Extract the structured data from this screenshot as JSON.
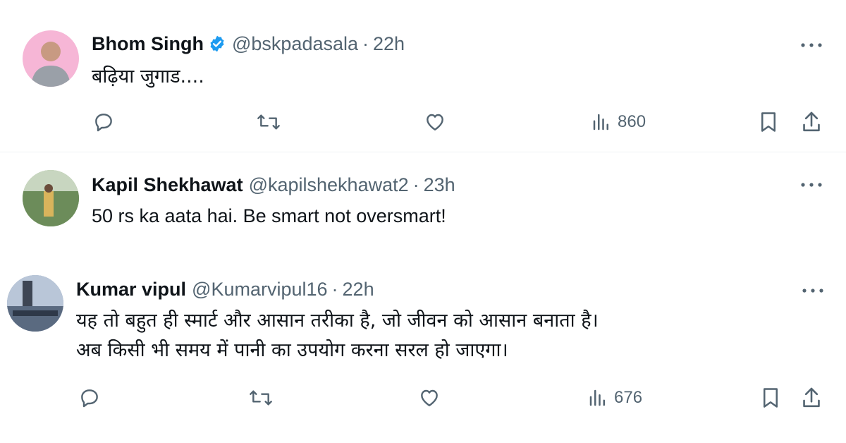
{
  "replies": [
    {
      "name": "Bhom Singh",
      "verified": true,
      "handle": "@bskpadasala",
      "time": "22h",
      "text": [
        "बढ़िया जुगाड...."
      ],
      "views": "860",
      "avatar_bg": "#f6b6d6"
    },
    {
      "name": "Kapil Shekhawat",
      "verified": false,
      "handle": "@kapilshekhawat2",
      "time": "23h",
      "text": [
        "50 rs ka aata hai. Be smart not oversmart!"
      ],
      "views": "",
      "avatar_bg": "#8fb07a"
    },
    {
      "name": "Kumar vipul",
      "verified": false,
      "handle": "@Kumarvipul16",
      "time": "22h",
      "text": [
        "यह तो बहुत ही स्मार्ट और आसान तरीका है, जो जीवन को आसान बनाता है।",
        "अब किसी भी समय में पानी का उपयोग करना सरल हो जाएगा।"
      ],
      "views": "676",
      "avatar_bg": "#7f95b5"
    }
  ],
  "separator": "·",
  "icons": [
    "reply-icon",
    "retweet-icon",
    "like-icon",
    "views-icon",
    "bookmark-icon",
    "share-icon",
    "more-icon",
    "verified-badge-icon"
  ],
  "colors": {
    "text": "#0f1419",
    "muted": "#536471",
    "verified": "#1d9bf0",
    "divider": "#eff3f4"
  }
}
